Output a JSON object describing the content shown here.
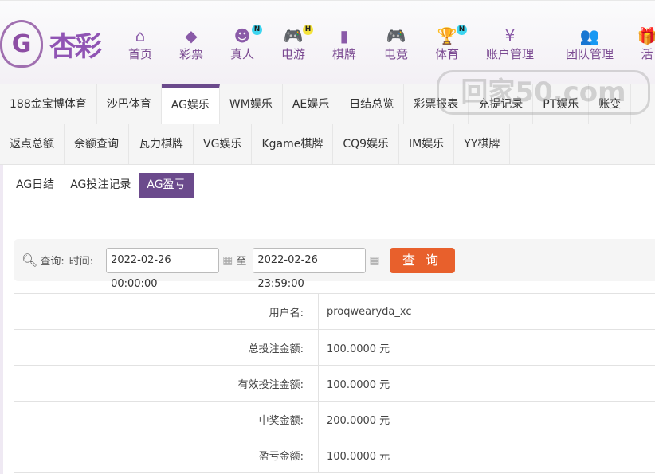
{
  "logo": {
    "mark": "G",
    "text": "杏彩"
  },
  "nav": [
    {
      "label": "首页",
      "icon": "home-icon",
      "glyph": "⌂"
    },
    {
      "label": "彩票",
      "icon": "ticket-icon",
      "glyph": "◆"
    },
    {
      "label": "真人",
      "icon": "dealer-icon",
      "glyph": "☻",
      "badge": "N",
      "badge_color": "#3dd5f0"
    },
    {
      "label": "电游",
      "icon": "gamepad-icon",
      "glyph": "🎮",
      "badge": "H",
      "badge_color": "#f5e33b"
    },
    {
      "label": "棋牌",
      "icon": "cards-icon",
      "glyph": "▮"
    },
    {
      "label": "电竞",
      "icon": "gamepad-icon",
      "glyph": "🎮"
    },
    {
      "label": "体育",
      "icon": "trophy-icon",
      "glyph": "🏆",
      "badge": "N",
      "badge_color": "#3dd5f0"
    },
    {
      "label": "账户管理",
      "icon": "yen-icon",
      "glyph": "¥"
    },
    {
      "label": "团队管理",
      "icon": "team-icon",
      "glyph": "👥"
    },
    {
      "label": "活",
      "icon": "gift-icon",
      "glyph": "🎁"
    }
  ],
  "tabs_row1": [
    "188金宝博体育",
    "沙巴体育",
    "AG娱乐",
    "WM娱乐",
    "AE娱乐",
    "日结总览",
    "彩票报表",
    "充提记录",
    "PT娱乐",
    "账变"
  ],
  "tabs_row2": [
    "返点总额",
    "余额查询",
    "瓦力棋牌",
    "VG娱乐",
    "Kgame棋牌",
    "CQ9娱乐",
    "IM娱乐",
    "YY棋牌"
  ],
  "active_tab": "AG娱乐",
  "subtabs": [
    "AG日结",
    "AG投注记录",
    "AG盈亏"
  ],
  "active_subtab": "AG盈亏",
  "search": {
    "query_label": "查询:",
    "time_label": "时间:",
    "start": "2022-02-26 00:00:00",
    "to": "至",
    "end": "2022-02-26 23:59:00",
    "button": "查 询"
  },
  "rows": [
    {
      "label": "用户名:",
      "value": "proqwearyda_xc"
    },
    {
      "label": "总投注金额:",
      "value": "100.0000 元"
    },
    {
      "label": "有效投注金额:",
      "value": "100.0000 元"
    },
    {
      "label": "中奖金额:",
      "value": "200.0000 元"
    },
    {
      "label": "盈亏金额:",
      "value": "100.0000 元"
    }
  ],
  "watermark": "回家50.com",
  "colors": {
    "accent": "#6b4a8c",
    "button": "#e8602c"
  }
}
